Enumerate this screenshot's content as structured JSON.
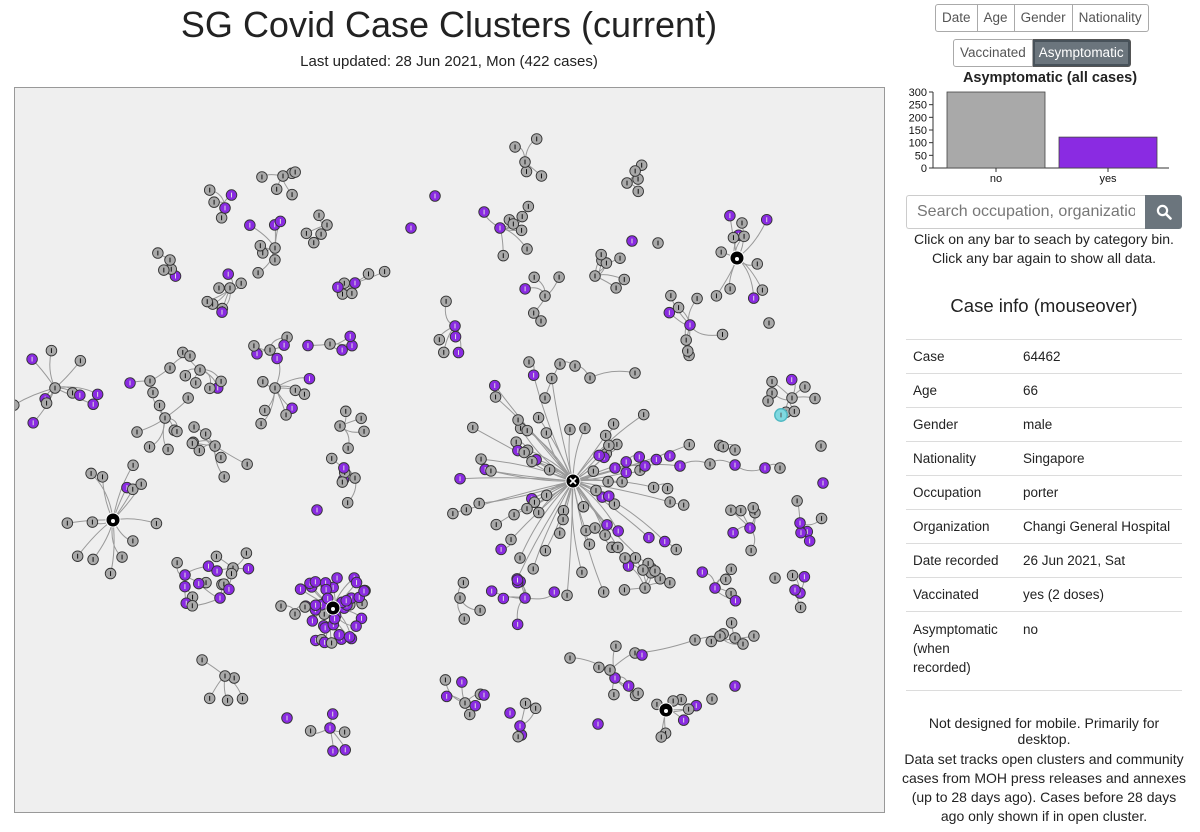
{
  "header": {
    "title": "SG Covid Case Clusters (current)",
    "subtitle": "Last updated: 28 Jun 2021, Mon (422 cases)"
  },
  "filters": {
    "row1": [
      "Date",
      "Age",
      "Gender",
      "Nationality"
    ],
    "row2": [
      "Vaccinated",
      "Asymptomatic"
    ],
    "active": "Asymptomatic"
  },
  "chart_data": {
    "type": "bar",
    "title": "Asymptomatic (all cases)",
    "categories": [
      "no",
      "yes"
    ],
    "values": [
      300,
      122
    ],
    "colors": [
      "#a9a9a9",
      "#8a2be2"
    ],
    "yticks": [
      "300",
      "250",
      "200",
      "150",
      "100",
      "50",
      "0"
    ],
    "ylim": [
      0,
      300
    ]
  },
  "search": {
    "placeholder": "Search occupation, organizatio"
  },
  "hint": "Click on any bar to seach by category bin. Click any bar again to show all data.",
  "case_info": {
    "title": "Case info (mouseover)",
    "rows": [
      {
        "key": "Case",
        "value": "64462"
      },
      {
        "key": "Age",
        "value": "66"
      },
      {
        "key": "Gender",
        "value": "male"
      },
      {
        "key": "Nationality",
        "value": "Singapore"
      },
      {
        "key": "Occupation",
        "value": "porter"
      },
      {
        "key": "Organization",
        "value": "Changi General Hospital"
      },
      {
        "key": "Date recorded",
        "value": "26 Jun 2021, Sat"
      },
      {
        "key": "Vaccinated",
        "value": "yes (2 doses)"
      },
      {
        "key": "Asymptomatic (when recorded)",
        "value": "no"
      }
    ]
  },
  "footer": {
    "note1": "Not designed for mobile. Primarily for desktop.",
    "note2": "Data set tracks open clusters and community cases from MOH press releases and annexes (up to 28 days ago). Cases before 28 days ago only shown if in open cluster."
  },
  "colors": {
    "node_no": "#a9a9a9",
    "node_yes": "#8a2be2",
    "node_hover": "#7fd8e0",
    "cluster_hub": "#000000",
    "active_button": "#6b757d"
  }
}
